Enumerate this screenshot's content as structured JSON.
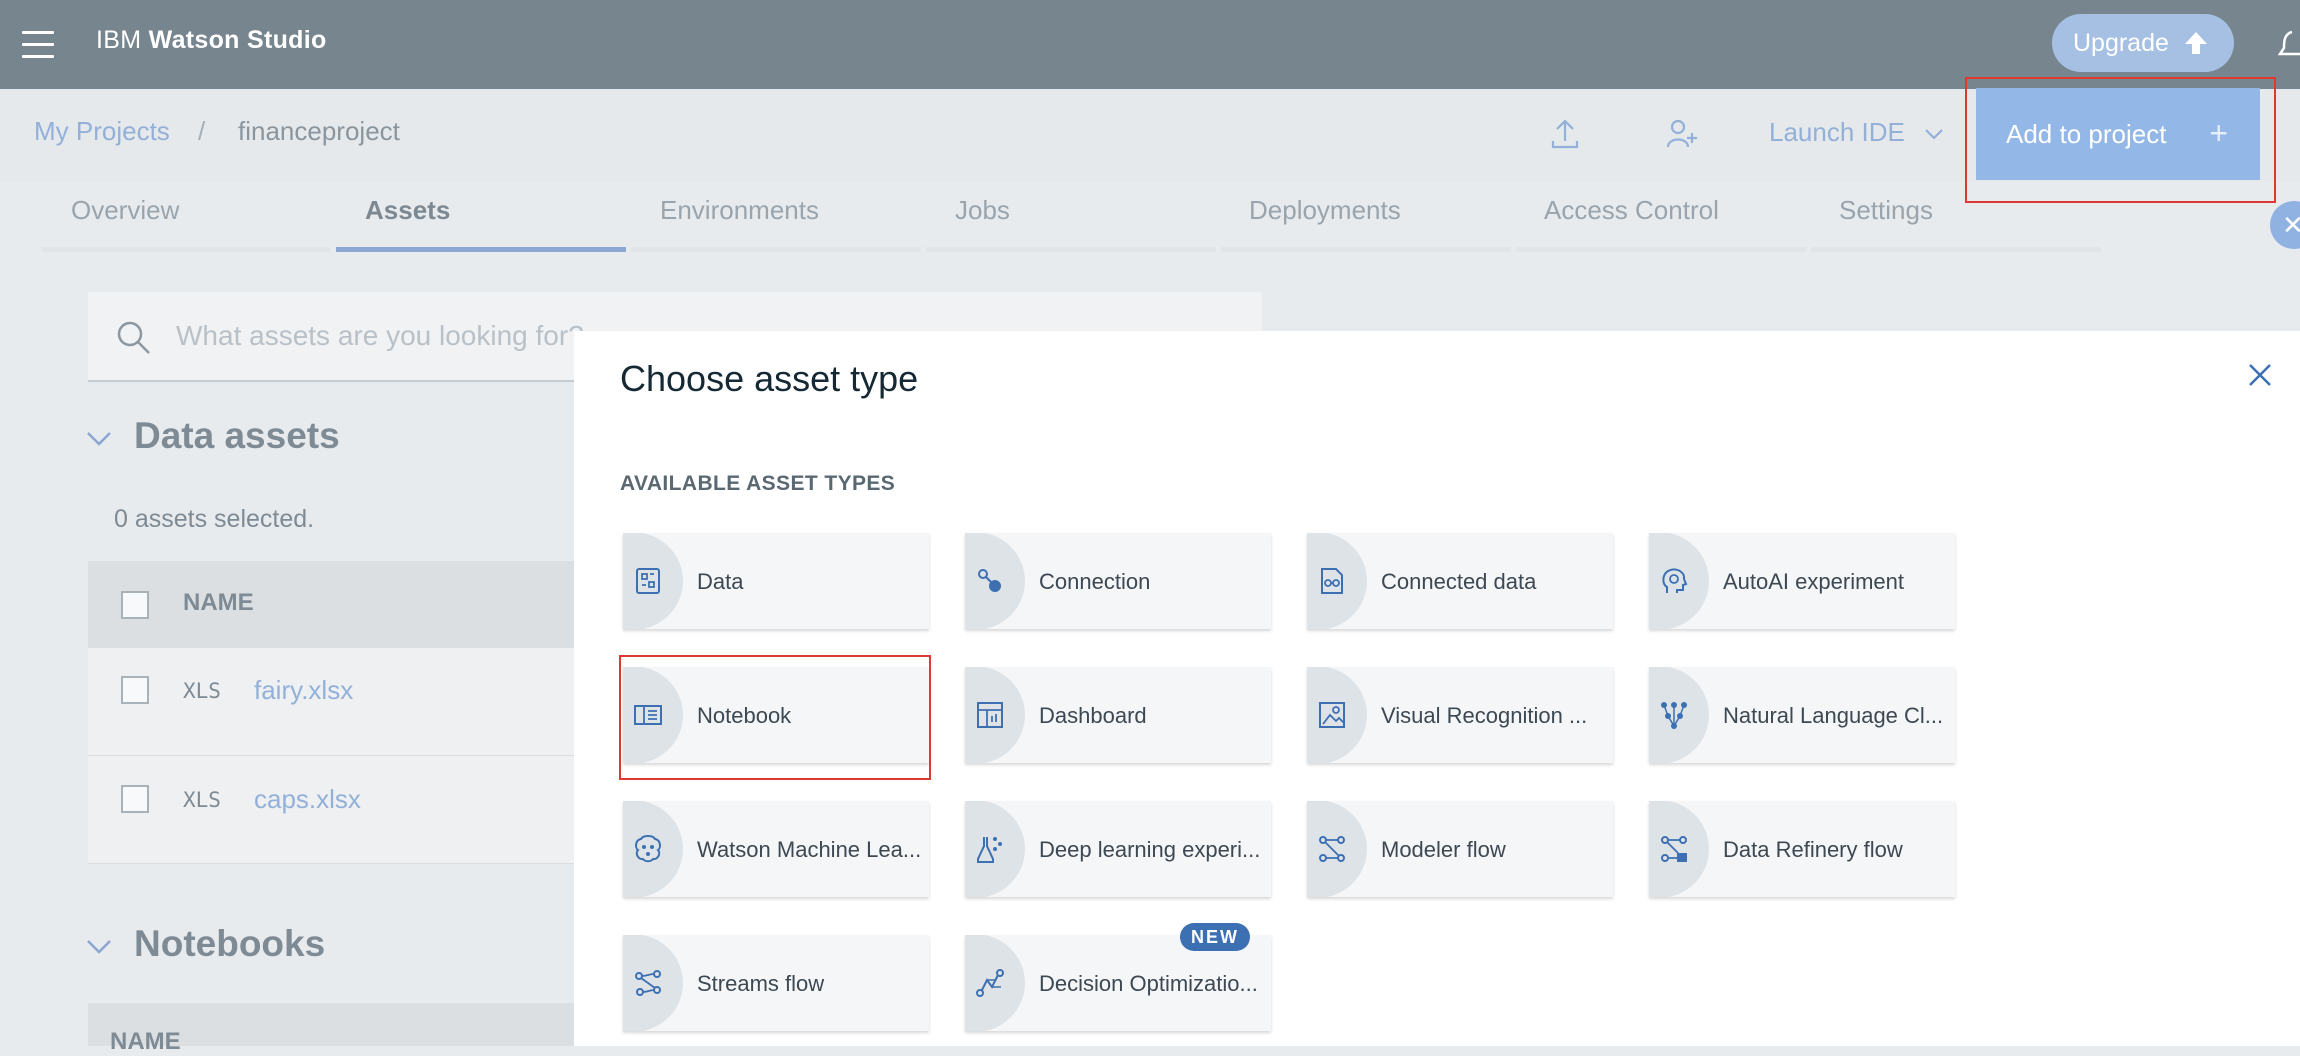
{
  "header": {
    "brand_prefix": "IBM",
    "brand_name": "Watson Studio",
    "upgrade_label": "Upgrade"
  },
  "breadcrumb": {
    "root": "My Projects",
    "separator": "/",
    "current": "financeproject"
  },
  "toolbar": {
    "launch_ide_label": "Launch IDE",
    "add_to_project_label": "Add to project",
    "add_plus": "+"
  },
  "tabs": [
    {
      "label": "Overview"
    },
    {
      "label": "Assets"
    },
    {
      "label": "Environments"
    },
    {
      "label": "Jobs"
    },
    {
      "label": "Deployments"
    },
    {
      "label": "Access Control"
    },
    {
      "label": "Settings"
    }
  ],
  "active_tab": "Assets",
  "search": {
    "placeholder": "What assets are you looking for?"
  },
  "data_assets": {
    "title": "Data assets",
    "selected_text": "0 assets selected.",
    "column_name": "NAME",
    "rows": [
      {
        "type": "XLS",
        "name": "fairy.xlsx"
      },
      {
        "type": "XLS",
        "name": "caps.xlsx"
      }
    ]
  },
  "notebooks": {
    "title": "Notebooks",
    "column_name": "NAME"
  },
  "dialog": {
    "title": "Choose asset type",
    "section_label": "AVAILABLE ASSET TYPES",
    "assets": [
      {
        "label": "Data",
        "icon": "data-icon"
      },
      {
        "label": "Connection",
        "icon": "connection-icon"
      },
      {
        "label": "Connected data",
        "icon": "connected-data-icon"
      },
      {
        "label": "AutoAI experiment",
        "icon": "autoai-icon"
      },
      {
        "label": "Notebook",
        "icon": "notebook-icon"
      },
      {
        "label": "Dashboard",
        "icon": "dashboard-icon"
      },
      {
        "label": "Visual Recognition ...",
        "icon": "visual-recognition-icon"
      },
      {
        "label": "Natural Language Cl...",
        "icon": "natural-language-icon"
      },
      {
        "label": "Watson Machine Lea...",
        "icon": "machine-learning-icon"
      },
      {
        "label": "Deep learning experi...",
        "icon": "deep-learning-icon"
      },
      {
        "label": "Modeler flow",
        "icon": "modeler-flow-icon"
      },
      {
        "label": "Data Refinery flow",
        "icon": "data-refinery-icon"
      },
      {
        "label": "Streams flow",
        "icon": "streams-flow-icon"
      },
      {
        "label": "Decision Optimizatio...",
        "icon": "decision-optimization-icon"
      }
    ],
    "new_badge": "NEW"
  },
  "colors": {
    "header_bg": "#77858f",
    "accent": "#3d70b2",
    "highlight_border": "#dc3a31"
  }
}
